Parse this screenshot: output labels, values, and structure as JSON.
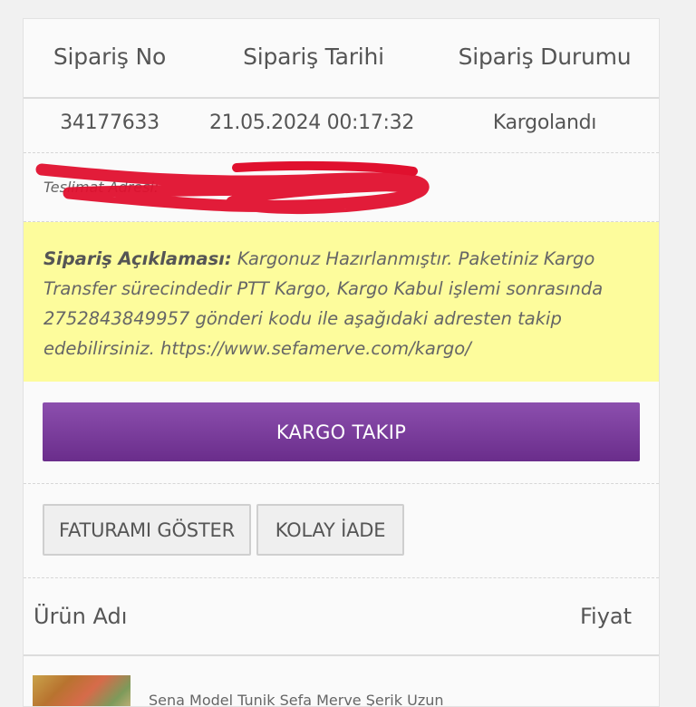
{
  "order_table": {
    "headers": [
      "Sipariş No",
      "Sipariş Tarihi",
      "Sipariş Durumu"
    ],
    "order_no": "34177633",
    "order_date": "21.05.2024 00:17:32",
    "order_status": "Kargolandı"
  },
  "delivery": {
    "label_partial": "Teslimat Adresi:"
  },
  "note": {
    "label": "Sipariş Açıklaması:",
    "text": "Kargonuz Hazırlanmıştır. Paketiniz Kargo Transfer sürecindedir PTT Kargo, Kargo Kabul işlemi sonrasında 2752843849957 gönderi kodu ile aşağıdaki adresten takip edebilirsiniz. https://www.sefamerve.com/kargo/"
  },
  "buttons": {
    "kargo_takip": "KARGO TAKIP",
    "fatura": "FATURAMI GÖSTER",
    "iade": "KOLAY İADE"
  },
  "products": {
    "headers": [
      "Ürün Adı",
      "Fiyat"
    ],
    "first_item_partial": "Sena Model Tunik Sefa Merve Şerik Uzun"
  },
  "colors": {
    "note_background": "#fdfc9c",
    "kargo_button": "#7a3b9c",
    "redaction": "#e0102e"
  }
}
